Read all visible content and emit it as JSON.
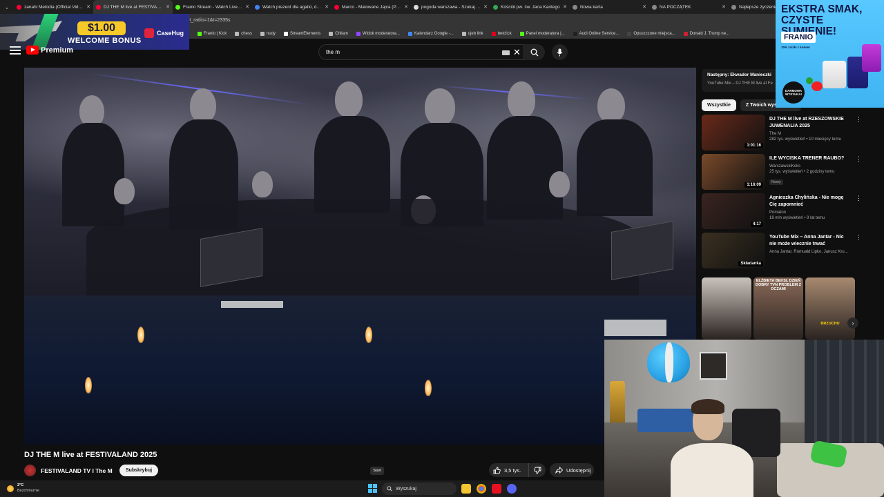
{
  "browser": {
    "tabs": [
      {
        "label": "zanahi Melodia (Official Video)",
        "favicon_color": "#ff0033",
        "active": false
      },
      {
        "label": "DJ THE M live at FESTIVALAND",
        "favicon_color": "#ff0033",
        "active": true
      },
      {
        "label": "Franio Stream - Watch Live on Kick",
        "favicon_color": "#53fc18",
        "active": false
      },
      {
        "label": "Watch prezent dla agatki, dark",
        "favicon_color": "#4285f4",
        "active": false
      },
      {
        "label": "Marco - Malowane Jajca (Parody)",
        "favicon_color": "#ff0033",
        "active": false
      },
      {
        "label": "pogoda warszawa - Szukaj w Google",
        "favicon_color": "#dddddd",
        "active": false
      },
      {
        "label": "Kościół pw. św. Jana Kantego",
        "favicon_color": "#34a853",
        "active": false
      },
      {
        "label": "Nowa karta",
        "favicon_color": "#888888",
        "active": false
      },
      {
        "label": "NA POCZĄTEK",
        "favicon_color": "#888888",
        "active": false
      },
      {
        "label": "Najlepsze życzenia",
        "favicon_color": "#888888",
        "active": false
      }
    ],
    "url_fragment": "rt_radio=1&t=2335s",
    "bookmarks": [
      {
        "label": "Franio | Kick",
        "color": "#53fc18"
      },
      {
        "label": "chess",
        "color": "#bbbbbb"
      },
      {
        "label": "nudy",
        "color": "#bbbbbb"
      },
      {
        "label": "StreamElements",
        "color": "#ffffff"
      },
      {
        "label": "Chilam",
        "color": "#bbbbbb"
      },
      {
        "label": "Widok moderatora...",
        "color": "#9146ff"
      },
      {
        "label": "Kalendarz Google -...",
        "color": "#4285f4"
      },
      {
        "label": "ujeb link",
        "color": "#bbbbbb"
      },
      {
        "label": "betclick",
        "color": "#e2001a"
      },
      {
        "label": "Panel moderatora |...",
        "color": "#53fc18"
      },
      {
        "label": "Audi Online Service...",
        "color": "#222222"
      },
      {
        "label": "Opuszczone miejsca...",
        "color": "#444444"
      },
      {
        "label": "Donald J. Trump ne...",
        "color": "#cc2233"
      }
    ]
  },
  "ad_left": {
    "amount": "$1.00",
    "bonus": "WELCOME BONUS",
    "brand": "CaseHug"
  },
  "ad_right": {
    "headline": "EKSTRA SMAK, CZYSTE SUMIENIE!",
    "brand": "FRANIO",
    "tagline": "10% zniżki z kodem",
    "badge": "DARMOWA WYSYŁKA!"
  },
  "youtube": {
    "logo_text": "Premium",
    "search_query": "the m",
    "video_title": "DJ THE M live at FESTIVALAND 2025",
    "channel_name": "FESTIVALAND TV I The M",
    "subscribe_label": "Subskrybuj",
    "likes": "3,5 tys.",
    "share_label": "Udostępnij",
    "next_up": {
      "title": "Następny: Ekwador Manieczki",
      "subtitle": "YouTube Mix – DJ THE M live at Fe"
    },
    "chips": [
      "Wszystkie",
      "Z Twoich wyszukiwań"
    ],
    "recommendations": [
      {
        "title": "DJ THE M live at RZESZOWSKIE JUWENALIA 2025",
        "channel": "The M",
        "meta": "282 tys. wyświetleń • 10 miesięcy temu",
        "duration": "1:01:16",
        "badge": "",
        "thumb": "#6a2a1a"
      },
      {
        "title": "ILE WYCISKA TRENER RAUBO?",
        "channel": "WarszawskiKoks",
        "meta": "25 tys. wyświetleń • 2 godziny temu",
        "duration": "1:16:09",
        "badge": "Nowy",
        "thumb": "#7a4a2a"
      },
      {
        "title": "Agnieszka Chylińska - Nie mogę Cię zapomnieć",
        "channel": "Pomaton",
        "meta": "18 mln wyświetleń • 9 lat temu",
        "duration": "4:17",
        "badge": "",
        "thumb": "#3a2420"
      },
      {
        "title": "YouTube Mix – Anna Jantar - Nic nie może wiecznie trwać",
        "channel": "Anna Jantar, Romuald Lipko, Janusz Kru...",
        "meta": "",
        "duration": "Składanka",
        "badge": "",
        "thumb": "#3a3020"
      }
    ],
    "shorts": [
      {
        "caption": "",
        "color": "#c9c2bc"
      },
      {
        "caption": "ELŻBIETA BEKSL DZIEŃ DOBRY TVN PROBLEM Z OCZAMI",
        "color": "#8a6a58"
      },
      {
        "caption": "BRZUCHU",
        "color": "#a88a70"
      }
    ],
    "start_tooltip": "Start"
  },
  "taskbar": {
    "temperature": "2°C",
    "weather": "Bezchmurnie",
    "search_placeholder": "Wyszukaj"
  }
}
